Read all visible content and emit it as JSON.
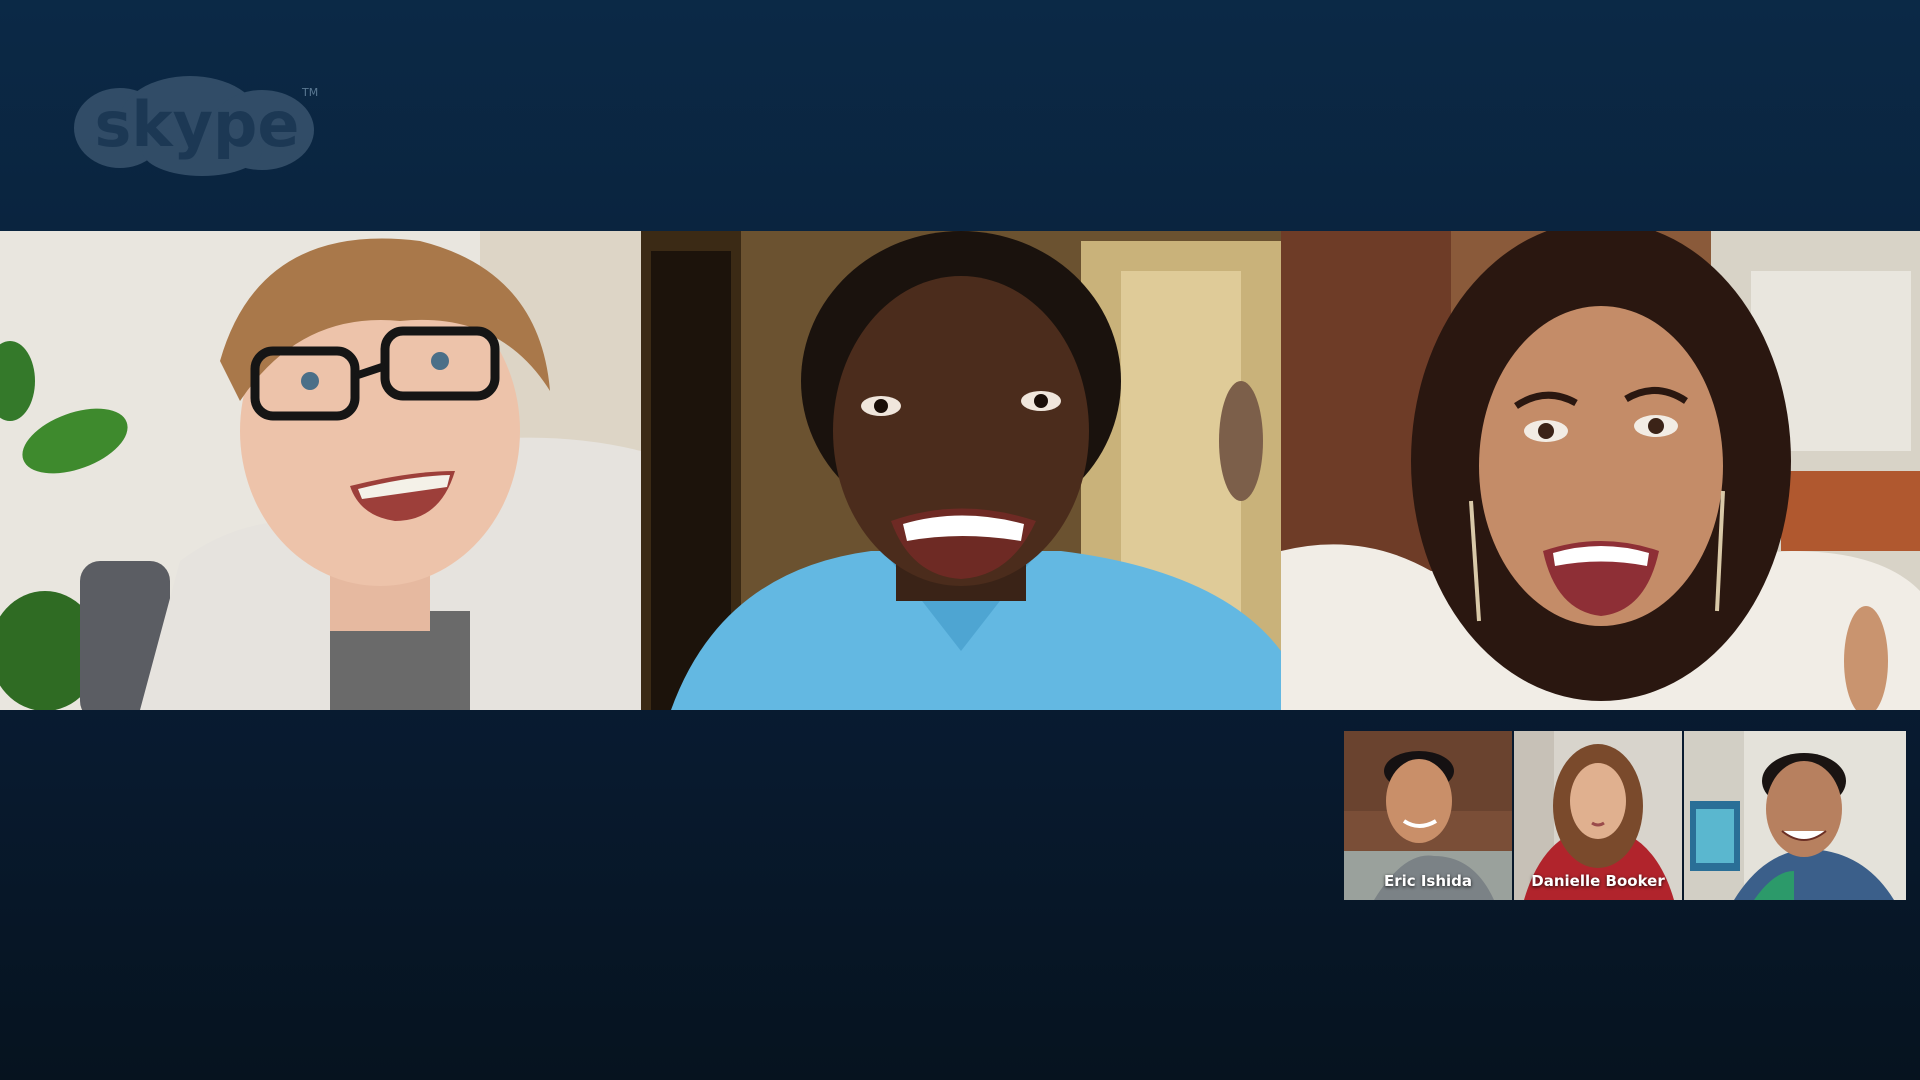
{
  "app": {
    "logo_text": "skype",
    "logo_mark": "TM"
  },
  "call": {
    "main_participants": [
      {
        "id": "p1",
        "speaking": true
      },
      {
        "id": "p2",
        "speaking": false
      },
      {
        "id": "p3",
        "speaking": false
      }
    ],
    "thumbnails": [
      {
        "name": "Eric Ishida"
      },
      {
        "name": "Danielle Booker"
      },
      {
        "name": ""
      }
    ]
  },
  "colors": {
    "background_top": "#0b2946",
    "background_bottom": "#06131f",
    "speaking_indicator": "#1f7fb8",
    "logo": "#3a5b78"
  }
}
